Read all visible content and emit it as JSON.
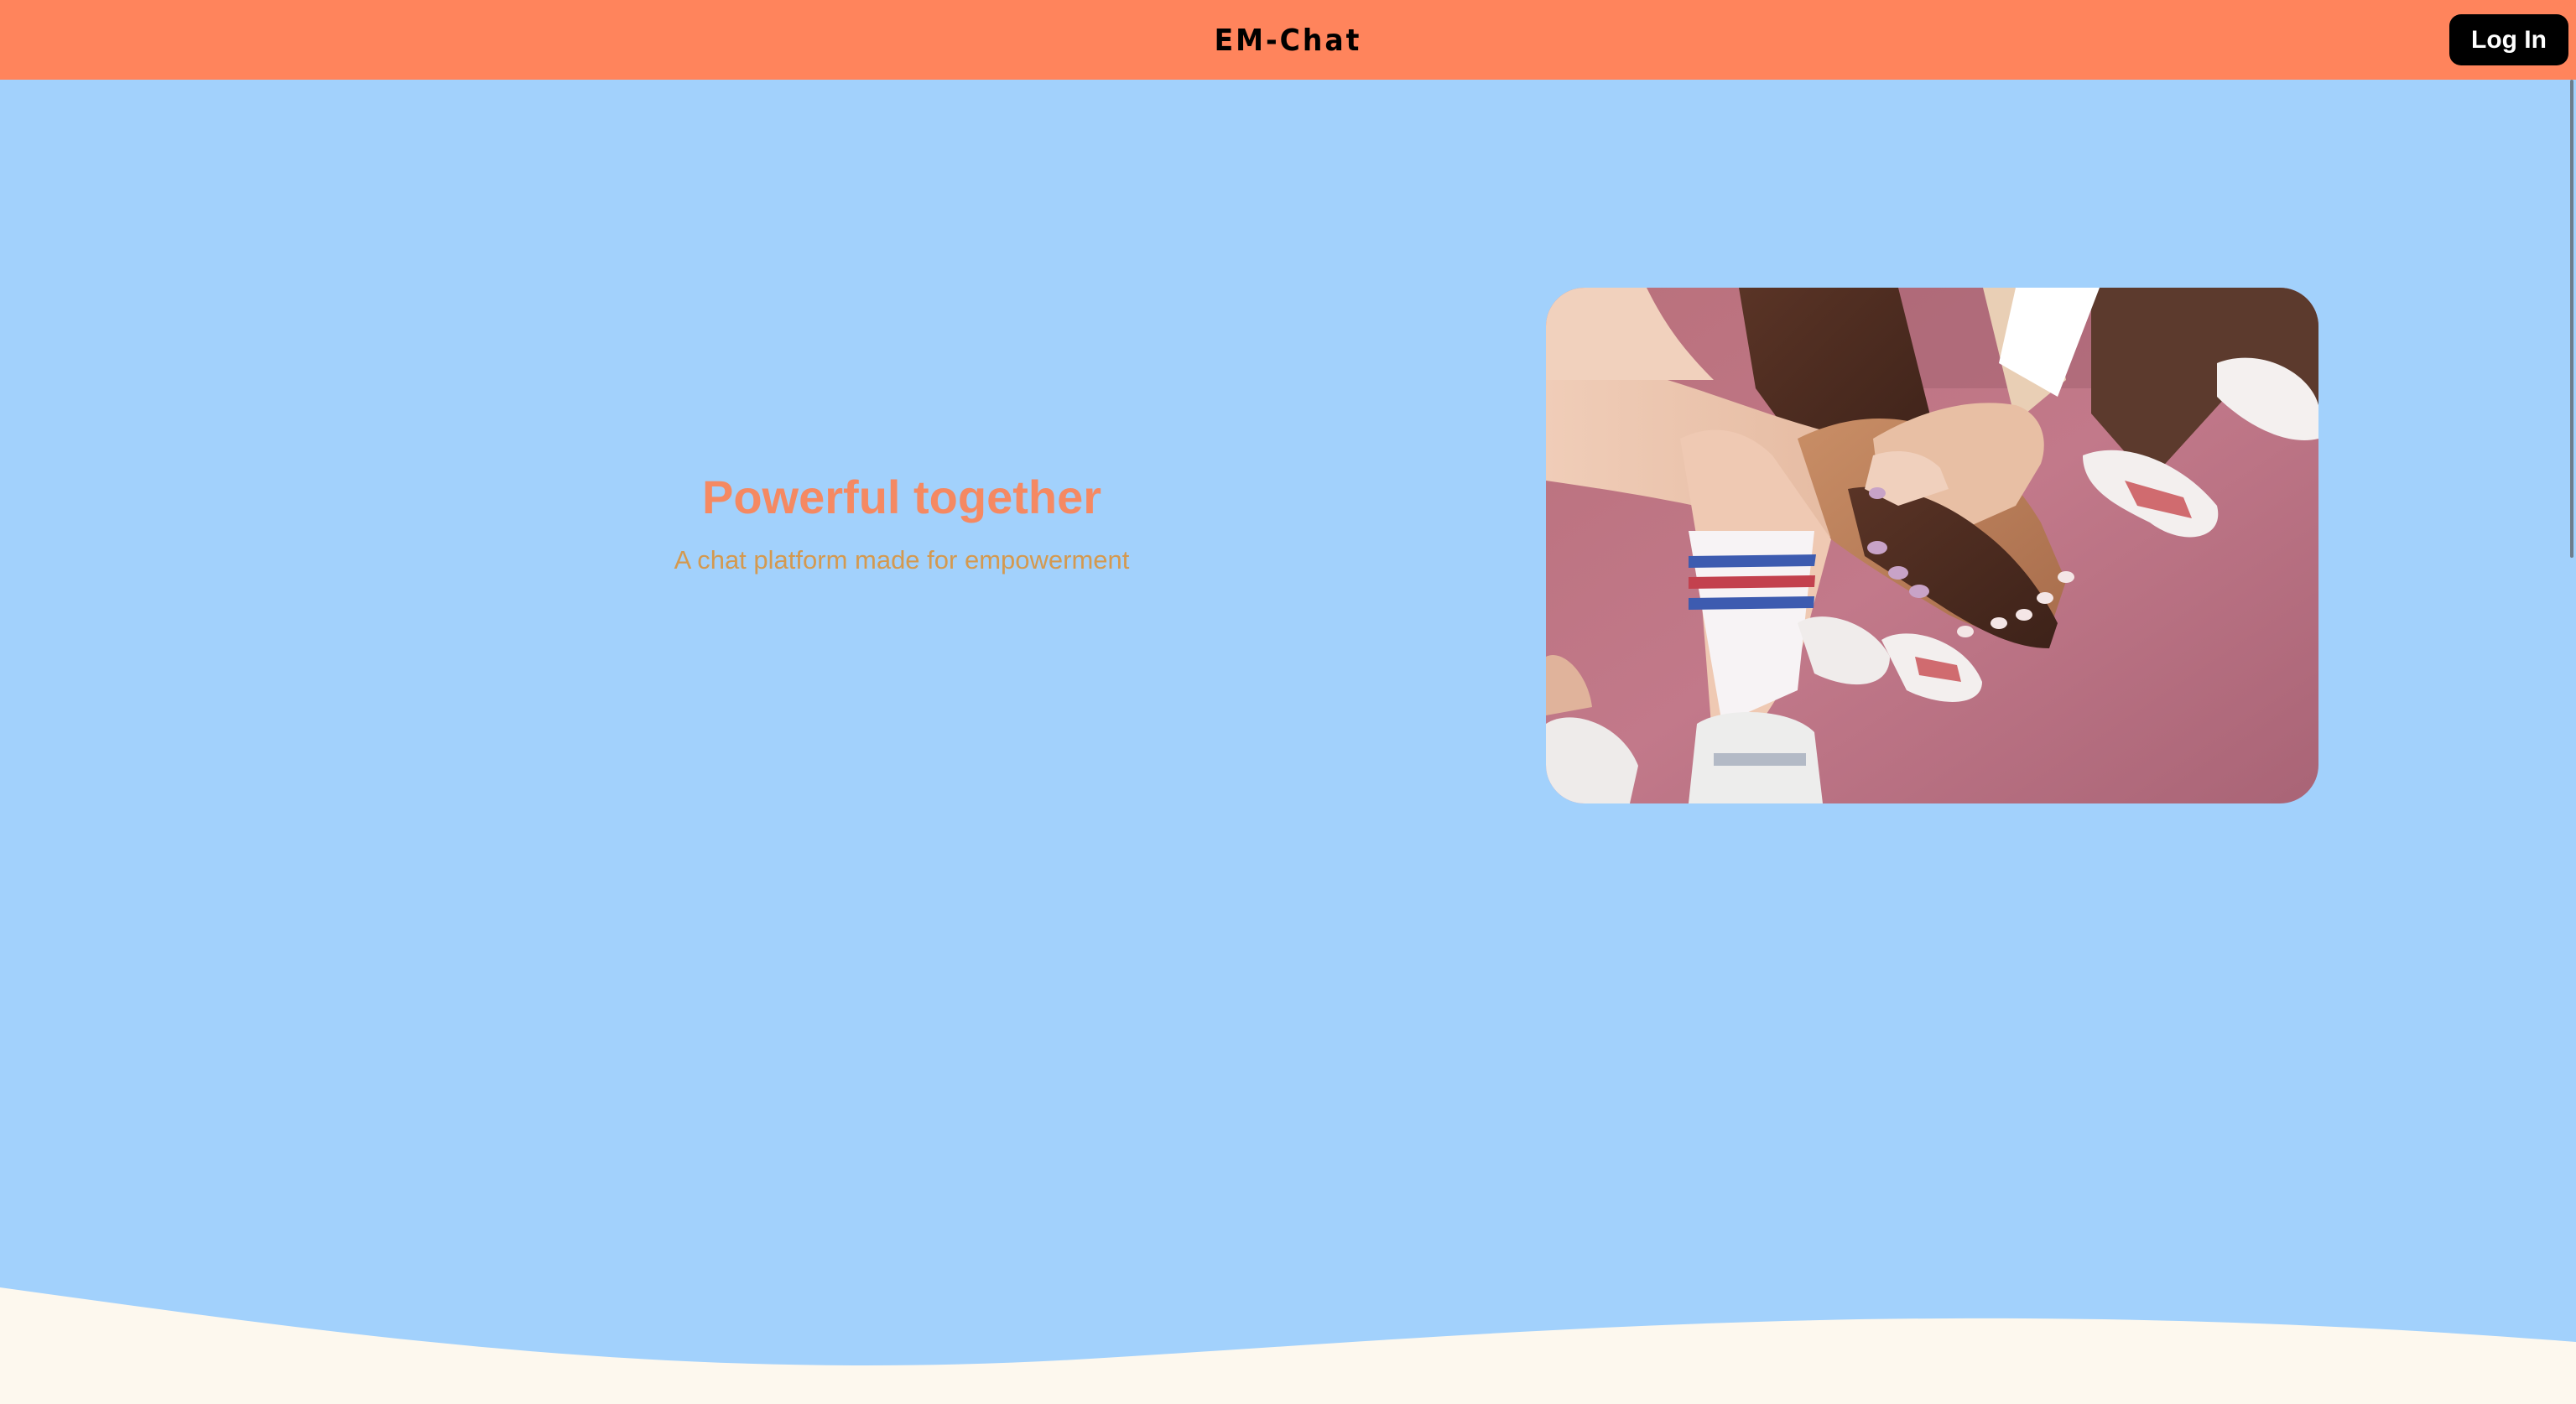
{
  "navbar": {
    "brand": "EM-Chat",
    "login_label": "Log In",
    "background": "#ff845c"
  },
  "hero": {
    "headline": "Powerful together",
    "subtitle": "A chat platform made for empowerment",
    "image_icon": "team-hands-photo",
    "background": "#a2d1fc",
    "headline_color": "#f58962",
    "subtitle_color": "#d4994f"
  },
  "footer": {
    "wave_color": "#fdf8ee"
  }
}
